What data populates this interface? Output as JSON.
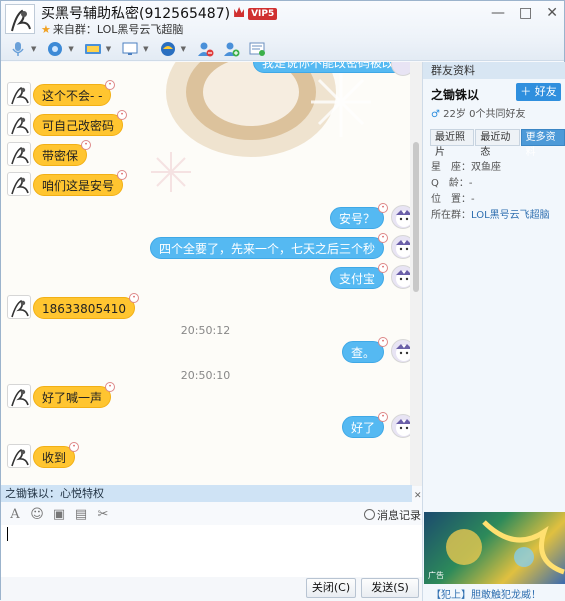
{
  "title": {
    "name": "买黑号辅助私密(912565487)",
    "vip": "VIP5",
    "from_group": "来自群：LOL黑号云飞超脑"
  },
  "window_controls": [
    "—",
    "□",
    "✕"
  ],
  "toolbar": {
    "icons": [
      "microphone-icon",
      "video-icon",
      "share-screen-icon",
      "remote-desktop-icon",
      "app-icon",
      "block-user-icon",
      "add-contact-icon",
      "more-icon"
    ]
  },
  "messages": [
    {
      "side": "left",
      "text": "这个不会- -"
    },
    {
      "side": "left",
      "text": "可自己改密码"
    },
    {
      "side": "left",
      "text": "带密保"
    },
    {
      "side": "left",
      "text": "咱们这是安号"
    },
    {
      "side": "right",
      "text": "安号？"
    },
    {
      "side": "right",
      "text": "四个全要了，先来一个，七天之后三个秒"
    },
    {
      "side": "right",
      "text": "支付宝"
    },
    {
      "side": "left",
      "text": "18633805410"
    },
    {
      "side": "time",
      "text": "20:50:12"
    },
    {
      "side": "right",
      "text": "查。"
    },
    {
      "side": "time",
      "text": "20:50:10"
    },
    {
      "side": "left",
      "text": "好了喊一声"
    },
    {
      "side": "right",
      "text": "好了"
    },
    {
      "side": "left",
      "text": "收到"
    }
  ],
  "partial_top_message": "我是说你不能改密码被改?",
  "notice": {
    "text": "之锄铢以：心悦特权",
    "close": "✕"
  },
  "input_toolbar": {
    "history": "消息记录"
  },
  "buttons": {
    "close": "关闭(C)",
    "send": "发送(S)"
  },
  "panel": {
    "header": "群友资料",
    "name": "之锄铢以",
    "add_friend": "＋ 好友",
    "age": "22岁",
    "common_friends": "0个共同好友",
    "tabs": [
      "最近照片",
      "最近动态",
      "更多资料"
    ],
    "active_tab": 2,
    "fields": [
      {
        "label": "星　座：",
        "value": "双鱼座"
      },
      {
        "label": "Q　龄：",
        "value": "-"
      },
      {
        "label": "位　置：",
        "value": "-"
      },
      {
        "label": "所在群：",
        "value": "LOL黑号云飞超脑"
      }
    ],
    "ad_tag": "广告",
    "ad_caption": "【犯上】胆敢触犯龙威！"
  },
  "colors": {
    "yellow_bubble": "#ffc530",
    "blue_bubble": "#55b9f2",
    "accent": "#2f8fde"
  }
}
